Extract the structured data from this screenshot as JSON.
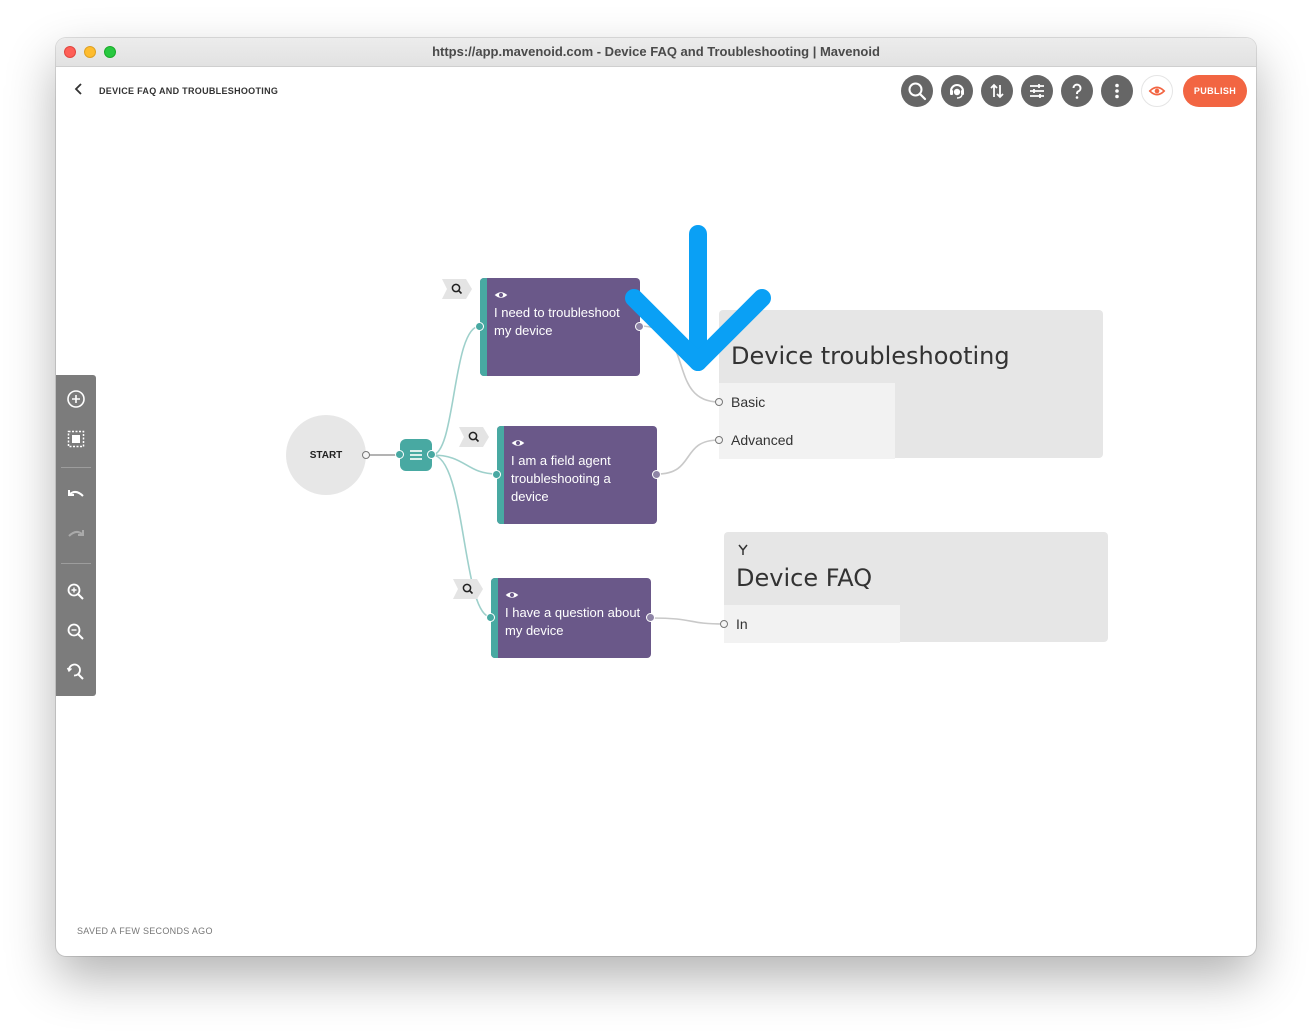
{
  "window": {
    "title": "https://app.mavenoid.com - Device FAQ and Troubleshooting | Mavenoid"
  },
  "header": {
    "back_icon": "chevron-left-icon",
    "title": "DEVICE FAQ AND TROUBLESHOOTING",
    "toolbar_icons": [
      "search-icon",
      "support-agent-icon",
      "sort-arrows-icon",
      "sliders-icon",
      "help-icon",
      "more-vertical-icon",
      "eye-icon"
    ],
    "publish_label": "PUBLISH",
    "colors": {
      "publish": "#f26542",
      "icon_button": "#666666"
    }
  },
  "sidebar_tools": {
    "icons": [
      "add-circle-icon",
      "select-area-icon",
      "undo-icon",
      "redo-icon",
      "zoom-in-icon",
      "zoom-out-icon",
      "zoom-reset-icon"
    ]
  },
  "canvas": {
    "start_label": "START",
    "router_icon": "list-icon",
    "questions": [
      {
        "text": "I need to troubleshoot my device"
      },
      {
        "text": "I am a field agent troubleshooting a device"
      },
      {
        "text": "I have a question about my device"
      }
    ],
    "flows": [
      {
        "title": "Device troubleshooting",
        "inputs": [
          "Basic",
          "Advanced"
        ]
      },
      {
        "title": "Device FAQ",
        "icon": "merge-icon",
        "inputs": [
          "In"
        ]
      }
    ],
    "annotation": "blue-arrow-down-icon",
    "colors": {
      "question_node": "#6a5889",
      "accent": "#48a9a2",
      "flow_box": "#e6e6e6",
      "annotation": "#0aa0f5"
    }
  },
  "footer": {
    "saved_text": "SAVED A FEW SECONDS AGO"
  }
}
